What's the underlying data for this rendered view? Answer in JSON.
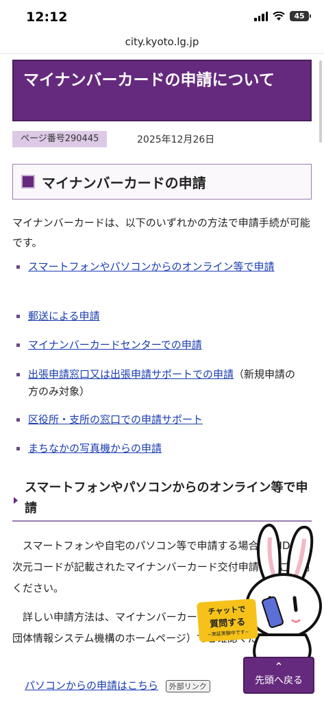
{
  "status": {
    "time": "12:12",
    "battery": "45"
  },
  "browser": {
    "url": "city.kyoto.lg.jp"
  },
  "page": {
    "title": "マイナンバーカードの申請について",
    "page_number": "ページ番号290445",
    "date": "2025年12月26日",
    "section_heading": "マイナンバーカードの申請",
    "intro": "マイナンバーカードは、以下のいずれかの方法で申請手続が可能です。",
    "links": [
      {
        "text": "スマートフォンやパソコンからのオンライン等で申請",
        "suffix": ""
      },
      {
        "text": "郵送による申請",
        "suffix": ""
      },
      {
        "text": "マイナンバーカードセンターでの申請",
        "suffix": ""
      },
      {
        "text": "出張申請窓口又は出張申請サポートでの申請",
        "suffix": "（新規申請の方のみ対象）"
      },
      {
        "text": "区役所・支所の窓口での申請サポート",
        "suffix": ""
      },
      {
        "text": "まちなかの写真機からの申請",
        "suffix": ""
      }
    ],
    "subsection_heading": "スマートフォンやパソコンからのオンライン等で申請",
    "para1": "スマートフォンや自宅のパソコン等で申請する場合は、IDや二次元コードが記載されたマイナンバーカード交付申請書をご利用ください。",
    "para2": "詳しい申請方法は、マイナンバーカード総合サイト（地方公共団体情報システム機構のホームページ）でご確認ください。",
    "pc_link": "パソコンからの申請はこちら",
    "external_badge": "外部リンク"
  },
  "chat": {
    "line1": "チャットで",
    "line2": "質問する",
    "line3": "~実証実験中です~"
  },
  "back_to_top": {
    "arrow": "⌃",
    "label": "先頭へ戻る"
  }
}
